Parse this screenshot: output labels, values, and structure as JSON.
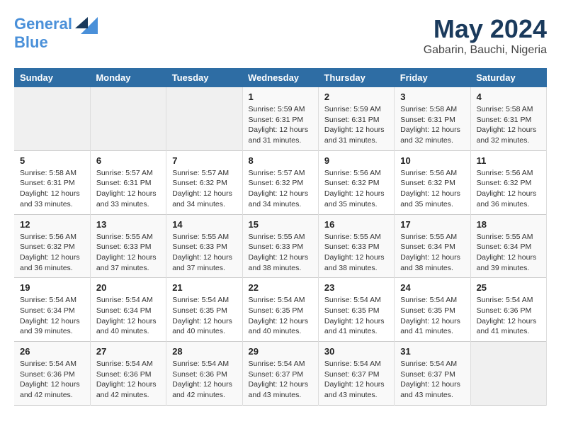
{
  "header": {
    "logo_line1": "General",
    "logo_line2": "Blue",
    "month": "May 2024",
    "location": "Gabarin, Bauchi, Nigeria"
  },
  "weekdays": [
    "Sunday",
    "Monday",
    "Tuesday",
    "Wednesday",
    "Thursday",
    "Friday",
    "Saturday"
  ],
  "weeks": [
    [
      {
        "num": "",
        "info": ""
      },
      {
        "num": "",
        "info": ""
      },
      {
        "num": "",
        "info": ""
      },
      {
        "num": "1",
        "info": "Sunrise: 5:59 AM\nSunset: 6:31 PM\nDaylight: 12 hours\nand 31 minutes."
      },
      {
        "num": "2",
        "info": "Sunrise: 5:59 AM\nSunset: 6:31 PM\nDaylight: 12 hours\nand 31 minutes."
      },
      {
        "num": "3",
        "info": "Sunrise: 5:58 AM\nSunset: 6:31 PM\nDaylight: 12 hours\nand 32 minutes."
      },
      {
        "num": "4",
        "info": "Sunrise: 5:58 AM\nSunset: 6:31 PM\nDaylight: 12 hours\nand 32 minutes."
      }
    ],
    [
      {
        "num": "5",
        "info": "Sunrise: 5:58 AM\nSunset: 6:31 PM\nDaylight: 12 hours\nand 33 minutes."
      },
      {
        "num": "6",
        "info": "Sunrise: 5:57 AM\nSunset: 6:31 PM\nDaylight: 12 hours\nand 33 minutes."
      },
      {
        "num": "7",
        "info": "Sunrise: 5:57 AM\nSunset: 6:32 PM\nDaylight: 12 hours\nand 34 minutes."
      },
      {
        "num": "8",
        "info": "Sunrise: 5:57 AM\nSunset: 6:32 PM\nDaylight: 12 hours\nand 34 minutes."
      },
      {
        "num": "9",
        "info": "Sunrise: 5:56 AM\nSunset: 6:32 PM\nDaylight: 12 hours\nand 35 minutes."
      },
      {
        "num": "10",
        "info": "Sunrise: 5:56 AM\nSunset: 6:32 PM\nDaylight: 12 hours\nand 35 minutes."
      },
      {
        "num": "11",
        "info": "Sunrise: 5:56 AM\nSunset: 6:32 PM\nDaylight: 12 hours\nand 36 minutes."
      }
    ],
    [
      {
        "num": "12",
        "info": "Sunrise: 5:56 AM\nSunset: 6:32 PM\nDaylight: 12 hours\nand 36 minutes."
      },
      {
        "num": "13",
        "info": "Sunrise: 5:55 AM\nSunset: 6:33 PM\nDaylight: 12 hours\nand 37 minutes."
      },
      {
        "num": "14",
        "info": "Sunrise: 5:55 AM\nSunset: 6:33 PM\nDaylight: 12 hours\nand 37 minutes."
      },
      {
        "num": "15",
        "info": "Sunrise: 5:55 AM\nSunset: 6:33 PM\nDaylight: 12 hours\nand 38 minutes."
      },
      {
        "num": "16",
        "info": "Sunrise: 5:55 AM\nSunset: 6:33 PM\nDaylight: 12 hours\nand 38 minutes."
      },
      {
        "num": "17",
        "info": "Sunrise: 5:55 AM\nSunset: 6:34 PM\nDaylight: 12 hours\nand 38 minutes."
      },
      {
        "num": "18",
        "info": "Sunrise: 5:55 AM\nSunset: 6:34 PM\nDaylight: 12 hours\nand 39 minutes."
      }
    ],
    [
      {
        "num": "19",
        "info": "Sunrise: 5:54 AM\nSunset: 6:34 PM\nDaylight: 12 hours\nand 39 minutes."
      },
      {
        "num": "20",
        "info": "Sunrise: 5:54 AM\nSunset: 6:34 PM\nDaylight: 12 hours\nand 40 minutes."
      },
      {
        "num": "21",
        "info": "Sunrise: 5:54 AM\nSunset: 6:35 PM\nDaylight: 12 hours\nand 40 minutes."
      },
      {
        "num": "22",
        "info": "Sunrise: 5:54 AM\nSunset: 6:35 PM\nDaylight: 12 hours\nand 40 minutes."
      },
      {
        "num": "23",
        "info": "Sunrise: 5:54 AM\nSunset: 6:35 PM\nDaylight: 12 hours\nand 41 minutes."
      },
      {
        "num": "24",
        "info": "Sunrise: 5:54 AM\nSunset: 6:35 PM\nDaylight: 12 hours\nand 41 minutes."
      },
      {
        "num": "25",
        "info": "Sunrise: 5:54 AM\nSunset: 6:36 PM\nDaylight: 12 hours\nand 41 minutes."
      }
    ],
    [
      {
        "num": "26",
        "info": "Sunrise: 5:54 AM\nSunset: 6:36 PM\nDaylight: 12 hours\nand 42 minutes."
      },
      {
        "num": "27",
        "info": "Sunrise: 5:54 AM\nSunset: 6:36 PM\nDaylight: 12 hours\nand 42 minutes."
      },
      {
        "num": "28",
        "info": "Sunrise: 5:54 AM\nSunset: 6:36 PM\nDaylight: 12 hours\nand 42 minutes."
      },
      {
        "num": "29",
        "info": "Sunrise: 5:54 AM\nSunset: 6:37 PM\nDaylight: 12 hours\nand 43 minutes."
      },
      {
        "num": "30",
        "info": "Sunrise: 5:54 AM\nSunset: 6:37 PM\nDaylight: 12 hours\nand 43 minutes."
      },
      {
        "num": "31",
        "info": "Sunrise: 5:54 AM\nSunset: 6:37 PM\nDaylight: 12 hours\nand 43 minutes."
      },
      {
        "num": "",
        "info": ""
      }
    ]
  ]
}
